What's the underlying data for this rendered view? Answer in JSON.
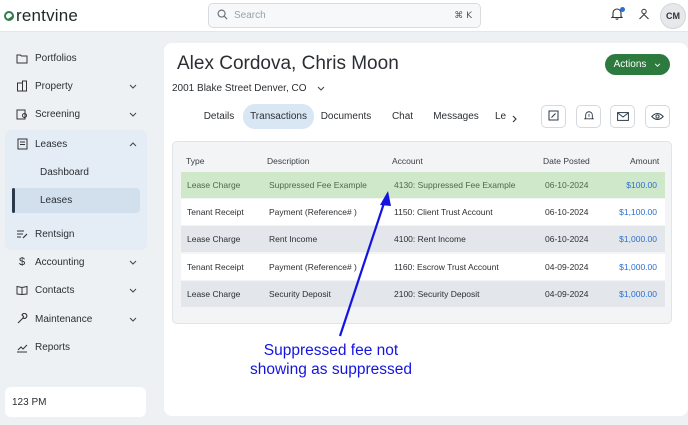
{
  "app": {
    "logo_text": "rentvine"
  },
  "search": {
    "placeholder": "Search",
    "shortcut": "⌘ K"
  },
  "user": {
    "initials": "CM"
  },
  "sidebar": {
    "items": [
      {
        "label": "Portfolios",
        "icon": "folders-icon"
      },
      {
        "label": "Property",
        "icon": "building-icon"
      },
      {
        "label": "Screening",
        "icon": "screening-icon"
      },
      {
        "label": "Leases",
        "icon": "document-icon"
      },
      {
        "label": "Rentsign",
        "icon": "sign-icon"
      },
      {
        "label": "Accounting",
        "icon": "dollar-icon"
      },
      {
        "label": "Contacts",
        "icon": "book-icon"
      },
      {
        "label": "Maintenance",
        "icon": "wrench-icon"
      },
      {
        "label": "Reports",
        "icon": "chart-icon"
      }
    ],
    "leases_sub": [
      {
        "label": "Dashboard"
      },
      {
        "label": "Leases"
      }
    ],
    "time": "123 PM"
  },
  "lease": {
    "title": "Alex Cordova, Chris Moon",
    "address": "2001 Blake Street Denver, CO",
    "actions_label": "Actions"
  },
  "tabs": [
    {
      "label": "Details"
    },
    {
      "label": "Transactions"
    },
    {
      "label": "Documents"
    },
    {
      "label": "Chat"
    },
    {
      "label": "Messages"
    },
    {
      "label": "Le"
    }
  ],
  "table": {
    "headers": [
      "Type",
      "Description",
      "Account",
      "Date Posted",
      "Amount"
    ],
    "rows": [
      {
        "type": "Lease Charge",
        "description": "Suppressed Fee Example",
        "account": "4130: Suppressed Fee Example",
        "date": "06-10-2024",
        "amount": "$100.00"
      },
      {
        "type": "Tenant Receipt",
        "description": "Payment (Reference# )",
        "account": "1150: Client Trust Account",
        "date": "06-10-2024",
        "amount": "$1,100.00"
      },
      {
        "type": "Lease Charge",
        "description": "Rent Income",
        "account": "4100: Rent Income",
        "date": "06-10-2024",
        "amount": "$1,000.00"
      },
      {
        "type": "Tenant Receipt",
        "description": "Payment (Reference# )",
        "account": "1160: Escrow Trust Account",
        "date": "04-09-2024",
        "amount": "$1,000.00"
      },
      {
        "type": "Lease Charge",
        "description": "Security Deposit",
        "account": "2100: Security Deposit",
        "date": "04-09-2024",
        "amount": "$1,000.00"
      }
    ]
  },
  "annotation": {
    "line1": "Suppressed fee not",
    "line2": "showing as suppressed"
  },
  "colors": {
    "brand_green": "#2d7a3e",
    "link_blue": "#2b6fd1",
    "highlight_row": "#cfe8c9",
    "annotation_blue": "#1414e0"
  }
}
